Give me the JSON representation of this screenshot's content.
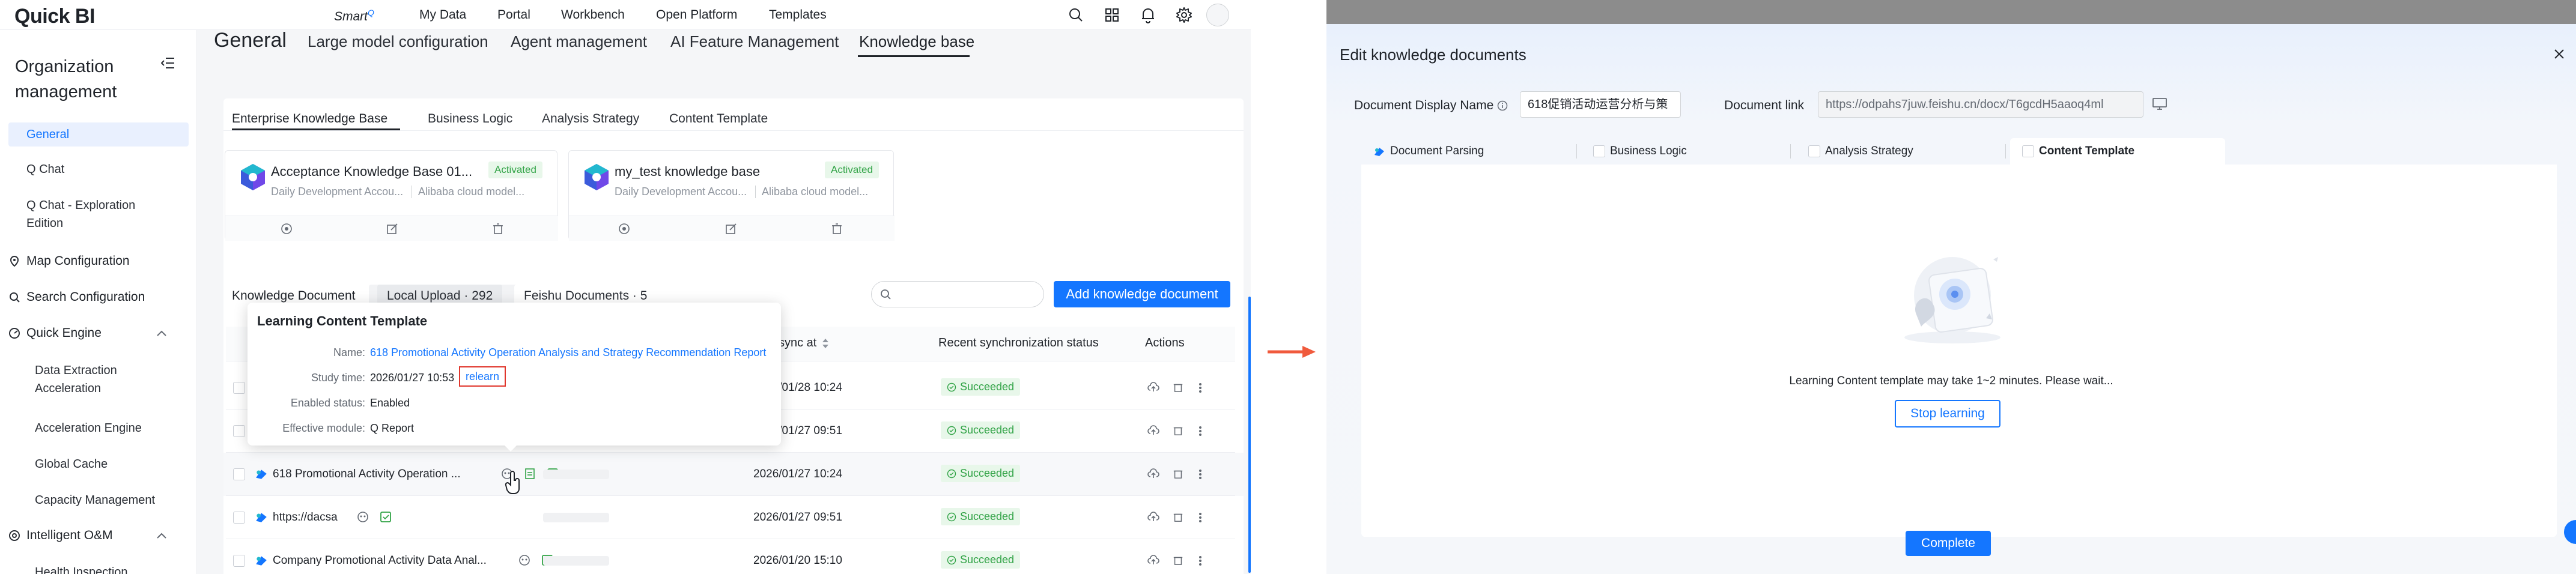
{
  "app": {
    "logo": "Quick BI",
    "nav": {
      "smart": "Smart",
      "smart_sup": "Q",
      "items": [
        "My Data",
        "Portal",
        "Workbench",
        "Open Platform",
        "Templates"
      ]
    }
  },
  "sidebar": {
    "title": "Organization management",
    "items": {
      "general": "General",
      "qchat": "Q Chat",
      "qchat_exp": "Q Chat - Exploration Edition",
      "map": "Map Configuration",
      "search": "Search Configuration",
      "quick_engine": "Quick Engine",
      "data_extract": "Data Extraction Acceleration",
      "accel_engine": "Acceleration Engine",
      "global_cache": "Global Cache",
      "capacity": "Capacity Management",
      "intelligent_om": "Intelligent O&M",
      "health": "Health Inspection"
    }
  },
  "top_tabs": [
    "General",
    "Large model configuration",
    "Agent management",
    "AI Feature Management",
    "Knowledge base"
  ],
  "sub_tabs": [
    "Enterprise Knowledge Base",
    "Business Logic",
    "Analysis Strategy",
    "Content Template"
  ],
  "kb_cards": [
    {
      "title": "Acceptance Knowledge Base 01...",
      "badge": "Activated",
      "sub1": "Daily Development Accou...",
      "sub2": "Alibaba cloud model..."
    },
    {
      "title": "my_test knowledge base",
      "badge": "Activated",
      "sub1": "Daily Development Accou...",
      "sub2": "Alibaba cloud model..."
    }
  ],
  "doc_tabs": {
    "knowledge": "Knowledge Document",
    "local": "Local Upload · 292",
    "feishu": "Feishu Documents · 5"
  },
  "add_button": "Add knowledge document",
  "table": {
    "headers": {
      "sync": "sync at",
      "status": "Recent synchronization status",
      "actions": "Actions"
    },
    "rows": [
      {
        "name": "",
        "time": "2026/01/28 10:24",
        "status": "Succeeded"
      },
      {
        "name": "",
        "time": "2026/01/27 09:51",
        "status": "Succeeded"
      },
      {
        "name": "618 Promotional Activity Operation ...",
        "time": "2026/01/27 10:24",
        "status": "Succeeded"
      },
      {
        "name": "https://dacsa",
        "time": "2026/01/27 09:51",
        "status": "Succeeded"
      },
      {
        "name": "Company Promotional Activity Data Anal...",
        "time": "2026/01/20 15:10",
        "status": "Succeeded"
      }
    ]
  },
  "popover": {
    "title": "Learning Content Template",
    "labels": {
      "name": "Name:",
      "study": "Study time:",
      "enabled": "Enabled status:",
      "module": "Effective module:"
    },
    "name": "618 Promotional Activity Operation Analysis and Strategy Recommendation Report",
    "study_time": "2026/01/27 10:53",
    "relearn": "relearn",
    "enabled": "Enabled",
    "module": "Q Report"
  },
  "modal": {
    "title": "Edit knowledge documents",
    "display_name_label": "Document Display Name",
    "display_name_value": "618促销活动运营分析与策",
    "link_label": "Document link",
    "link_value": "https://odpahs7juw.feishu.cn/docx/T6gcdH5aaoq4ml",
    "tabs": [
      "Document Parsing",
      "Business Logic",
      "Analysis Strategy",
      "Content Template"
    ],
    "wait_text": "Learning Content template may take 1~2 minutes. Please wait...",
    "stop_button": "Stop learning",
    "complete_button": "Complete"
  },
  "colors": {
    "primary": "#1476ff",
    "success": "#31a346",
    "success_bg": "#e8f7ea",
    "highlight": "#e0362c",
    "arrow": "#f05a3c"
  }
}
